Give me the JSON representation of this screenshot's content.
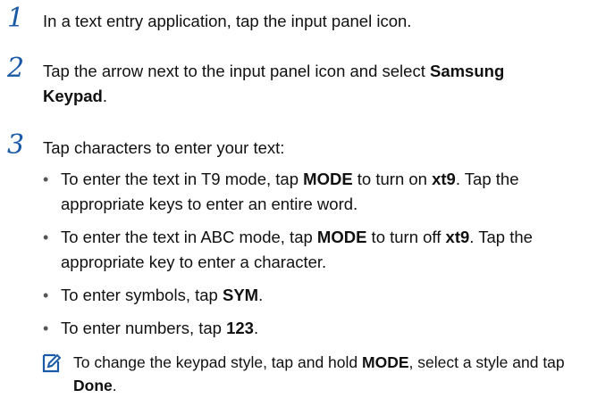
{
  "steps": [
    {
      "number": "1",
      "text": "In a text entry application, tap the input panel icon."
    },
    {
      "number": "2",
      "text_a": "Tap the arrow next to the input panel icon and select ",
      "bold_a": "Samsung",
      "bold_b": "Keypad",
      "text_b": "."
    },
    {
      "number": "3",
      "text": "Tap characters to enter your text:"
    }
  ],
  "bullets": [
    {
      "a": "To enter the text in T9 mode, tap ",
      "b1": "MODE",
      "c": " to turn on ",
      "b2": "xt9",
      "d": ". Tap the",
      "e": "appropriate keys to enter an entire word."
    },
    {
      "a": "To enter the text in ABC mode, tap ",
      "b1": "MODE",
      "c": " to turn off ",
      "b2": "xt9",
      "d": ". Tap the",
      "e": "appropriate key to enter a character."
    },
    {
      "a": "To enter symbols, tap ",
      "b1": "SYM",
      "c": "."
    },
    {
      "a": "To enter numbers, tap ",
      "b1": "123",
      "c": "."
    }
  ],
  "bullet_glyph": "•",
  "note": {
    "icon": "note-pencil-icon",
    "text_a": "To change the keypad style, tap and hold ",
    "bold_a": "MODE",
    "text_b": ", select a style and tap",
    "bold_b": "Done",
    "text_c": "."
  },
  "colors": {
    "step_number": "#1a5aa6",
    "note_icon": "#1a5aa6"
  }
}
